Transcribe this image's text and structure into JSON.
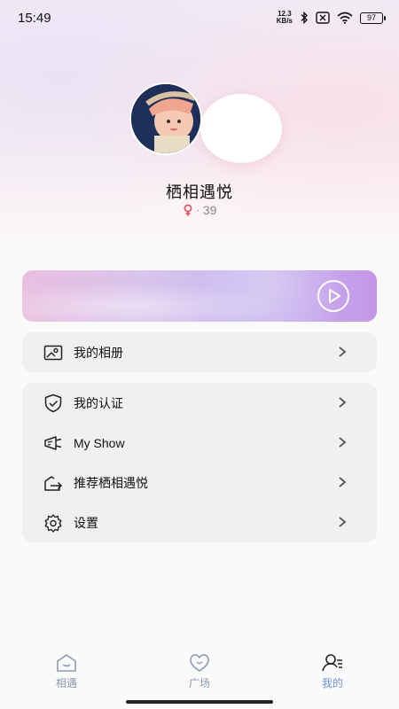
{
  "status_bar": {
    "time": "15:49",
    "net_speed_value": "12.3",
    "net_speed_unit": "KB/s",
    "battery": "97"
  },
  "profile": {
    "nickname": "栖相遇悦",
    "gender_icon": "female-symbol",
    "gender_color": "#e04a5a",
    "separator": "·",
    "age": "39"
  },
  "menu": {
    "album_label": "我的相册",
    "certification_label": "我的认证",
    "myshow_label": "My Show",
    "recommend_label": "推荐栖相遇悦",
    "settings_label": "设置"
  },
  "tab_bar": {
    "tabs": [
      {
        "label": "相遇",
        "icon": "home-icon",
        "active": false
      },
      {
        "label": "广场",
        "icon": "heart-icon",
        "active": false
      },
      {
        "label": "我的",
        "icon": "profile-icon",
        "active": true
      }
    ],
    "active_color": "#6f8fd8",
    "inactive_color": "#8c9ab0"
  }
}
